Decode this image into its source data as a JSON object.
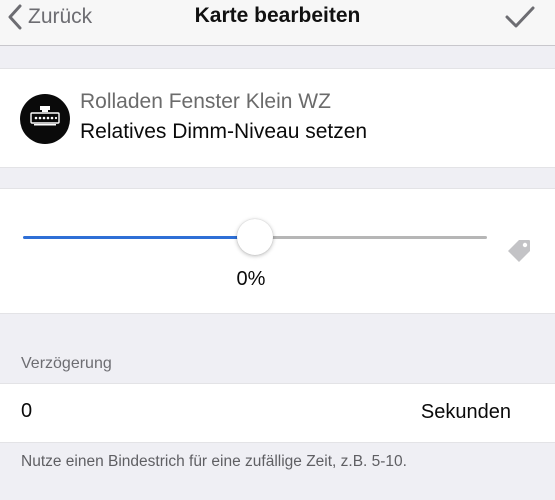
{
  "navbar": {
    "back_label": "Zurück",
    "title": "Karte bearbeiten"
  },
  "device": {
    "name": "Rolladen Fenster Klein WZ",
    "action": "Relatives Dimm-Niveau setzen",
    "avatar_icon": "roller-shutter-module-icon"
  },
  "slider": {
    "value_label": "0%",
    "value_fraction": 0.5,
    "accent_color": "#2e6fd6",
    "trailing_icon": "tag-icon"
  },
  "delay": {
    "label": "Verzögerung",
    "value": "0",
    "unit": "Sekunden",
    "hint": "Nutze einen Bindestrich für eine zufällige Zeit, z.B. 5-10."
  }
}
